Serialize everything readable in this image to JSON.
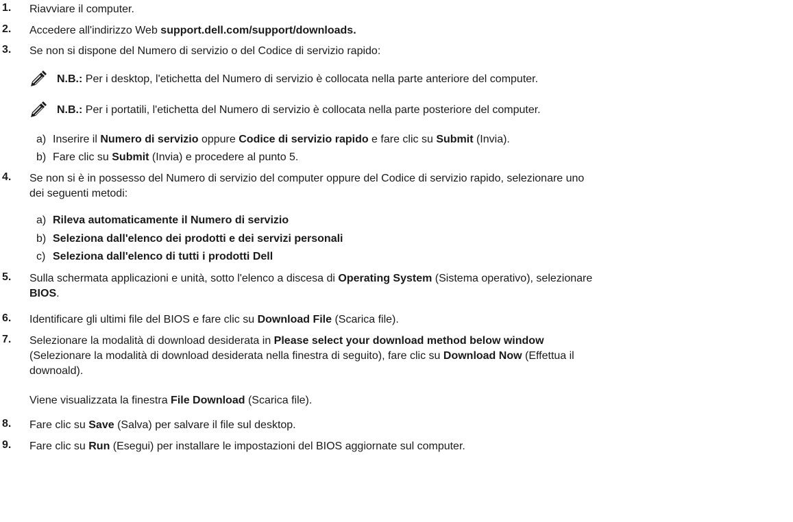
{
  "steps": [
    {
      "num": "1.",
      "parts": [
        "Riavviare il computer."
      ]
    },
    {
      "num": "2.",
      "parts": [
        "Accedere all'indirizzo Web ",
        "support.dell.com/support/downloads."
      ]
    },
    {
      "num": "3.",
      "parts": [
        "Se non si dispone del Numero di servizio o del Codice di servizio rapido:"
      ]
    },
    {
      "num": "4.",
      "line1": "Se non si è in possesso del Numero di servizio del computer oppure del Codice di servizio rapido, selezionare uno",
      "line2": "dei seguenti metodi:"
    },
    {
      "num": "5.",
      "parts": [
        "Sulla schermata applicazioni e unità, sotto l'elenco a discesa di ",
        "Operating System",
        " (Sistema operativo), selezionare",
        "BIOS",
        "."
      ]
    },
    {
      "num": "6.",
      "parts": [
        "Identificare gli ultimi file del BIOS e fare clic su ",
        "Download File",
        " (Scarica file)."
      ]
    },
    {
      "num": "7.",
      "parts": [
        "Selezionare la modalità di download desiderata in ",
        "Please select your download method below window",
        "(Selezionare la modalità di download desiderata nella finestra di seguito), fare clic su ",
        "Download Now",
        " (Effettua il",
        "downoald)."
      ]
    },
    {
      "num": "8.",
      "parts": [
        "Fare clic su ",
        "Save",
        " (Salva) per salvare il file sul desktop."
      ]
    },
    {
      "num": "9.",
      "parts": [
        "Fare clic su ",
        "Run",
        " (Esegui) per installare le impostazioni del BIOS aggiornate sul computer."
      ]
    }
  ],
  "notes": [
    {
      "label": "N.B.:",
      "text": " Per i desktop, l'etichetta del Numero di servizio è collocata nella parte anteriore del computer."
    },
    {
      "label": "N.B.:",
      "text": " Per i portatili, l'etichetta del Numero di servizio è collocata nella parte posteriore del computer."
    }
  ],
  "substeps3": [
    {
      "letter": "a)",
      "parts": [
        "Inserire il ",
        "Numero di servizio",
        " oppure ",
        "Codice di servizio rapido",
        " e fare clic su ",
        "Submit",
        " (Invia)."
      ]
    },
    {
      "letter": "b)",
      "parts": [
        "Fare clic su ",
        "Submit",
        " (Invia) e procedere al punto 5."
      ]
    }
  ],
  "substeps4": [
    {
      "letter": "a)",
      "text": "Rileva automaticamente il Numero di servizio"
    },
    {
      "letter": "b)",
      "text": "Seleziona dall'elenco dei prodotti e dei servizi personali"
    },
    {
      "letter": "c)",
      "text": "Seleziona dall'elenco di tutti i prodotti Dell"
    }
  ],
  "step7_result": [
    "Viene visualizzata la finestra ",
    "File Download",
    " (Scarica file)."
  ],
  "colors": {
    "text": "#1a1a1a",
    "icon": "#1a1a1a"
  },
  "icons": {
    "note": "pencil-note-icon"
  }
}
